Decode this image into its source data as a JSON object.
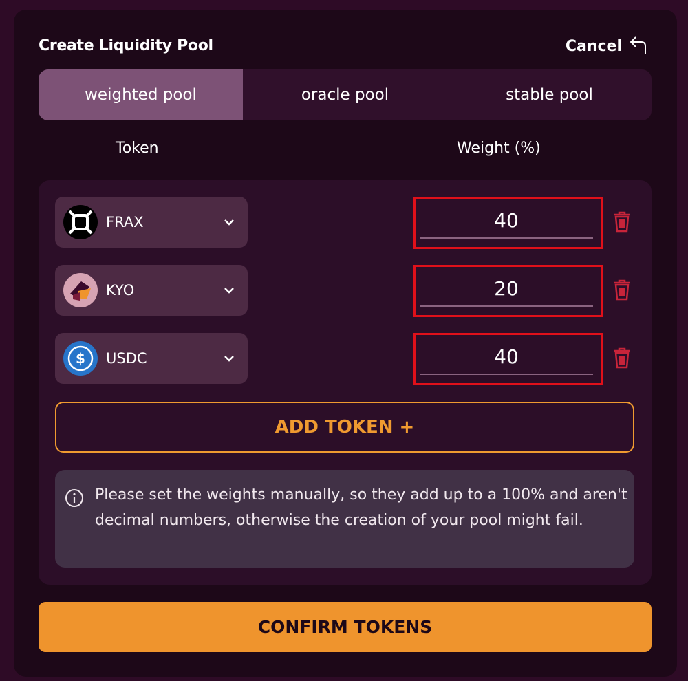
{
  "header": {
    "title": "Create Liquidity Pool",
    "cancel_label": "Cancel"
  },
  "tabs": [
    {
      "label": "weighted pool",
      "active": true
    },
    {
      "label": "oracle pool",
      "active": false
    },
    {
      "label": "stable pool",
      "active": false
    }
  ],
  "columns": {
    "token": "Token",
    "weight": "Weight (%)"
  },
  "tokens": [
    {
      "symbol": "FRAX",
      "weight": "40",
      "icon": "frax-icon"
    },
    {
      "symbol": "KYO",
      "weight": "20",
      "icon": "kyo-icon"
    },
    {
      "symbol": "USDC",
      "weight": "40",
      "icon": "usdc-icon"
    }
  ],
  "add_token_label": "ADD TOKEN +",
  "info_message": "Please set the weights manually, so they add up to a 100% and aren't decimal numbers, otherwise the creation of your pool might fail.",
  "confirm_label": "CONFIRM TOKENS",
  "colors": {
    "accent": "#ef942d",
    "active_tab": "#7d5276",
    "highlight": "#e0101a",
    "danger": "#c8243a"
  }
}
